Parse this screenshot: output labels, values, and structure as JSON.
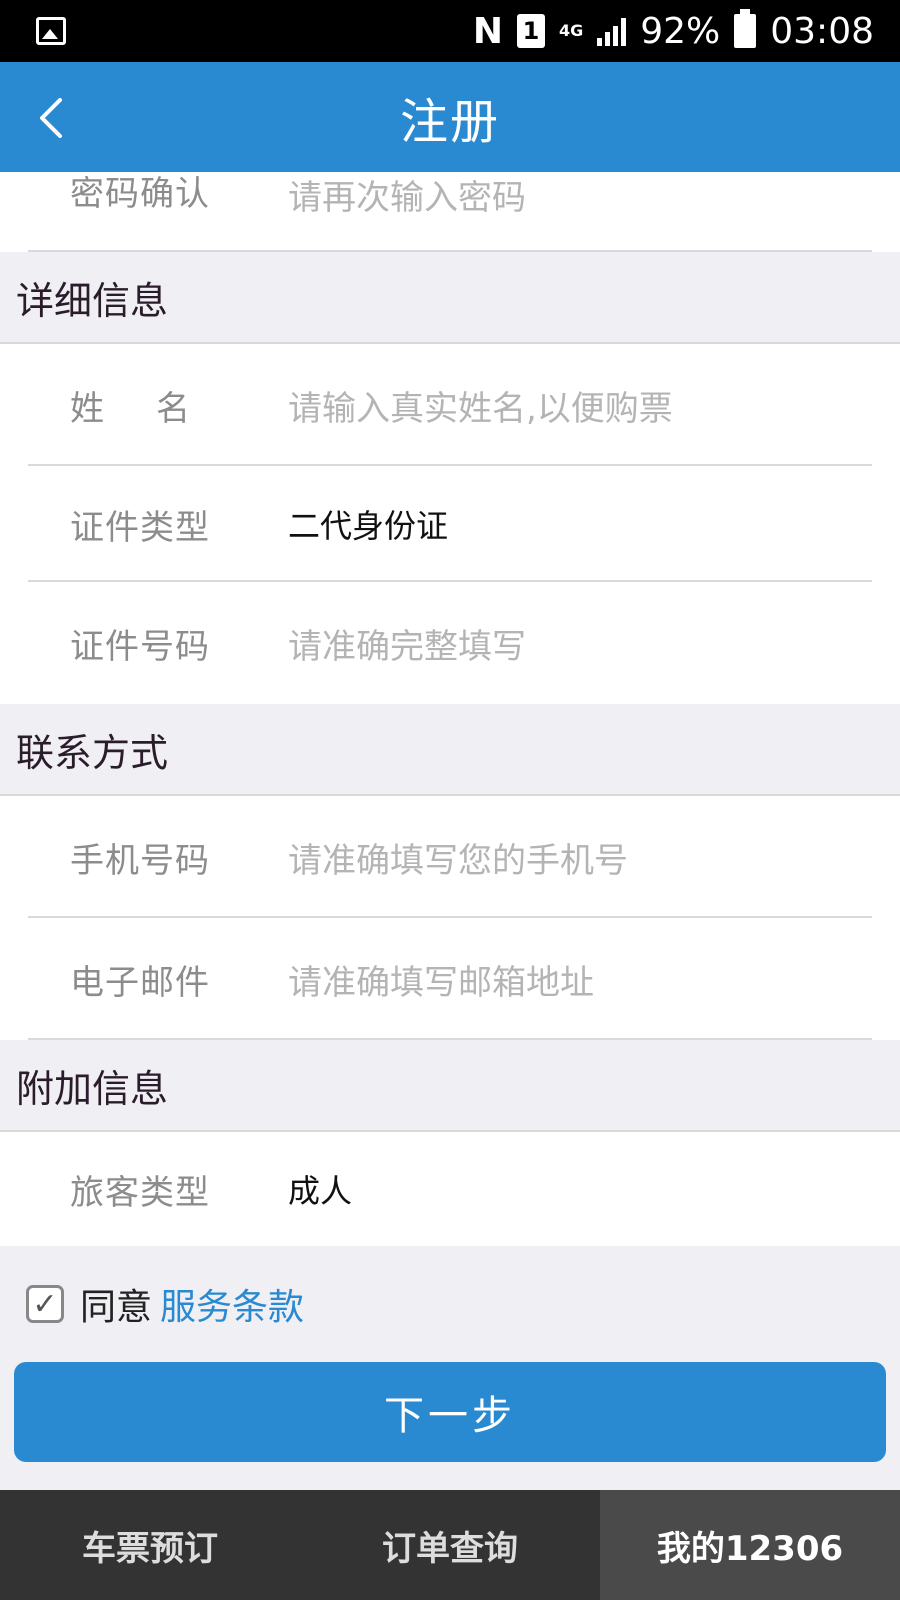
{
  "status_bar": {
    "battery": "92%",
    "time": "03:08",
    "nfc": "N",
    "sim": "1",
    "network": "4G"
  },
  "header": {
    "title": "注册"
  },
  "fields_top": [
    {
      "label": "密码确认",
      "placeholder": "请再次输入密码"
    }
  ],
  "sections": {
    "details": {
      "title": "详细信息",
      "name": {
        "label": "姓名",
        "placeholder": "请输入真实姓名,以便购票"
      },
      "id_type": {
        "label": "证件类型",
        "value": "二代身份证"
      },
      "id_number": {
        "label": "证件号码",
        "placeholder": "请准确完整填写"
      }
    },
    "contact": {
      "title": "联系方式",
      "phone": {
        "label": "手机号码",
        "placeholder": "请准确填写您的手机号"
      },
      "email": {
        "label": "电子邮件",
        "placeholder": "请准确填写邮箱地址"
      }
    },
    "extra": {
      "title": "附加信息",
      "passenger_type": {
        "label": "旅客类型",
        "value": "成人"
      }
    }
  },
  "agreement": {
    "text": "同意",
    "link": "服务条款",
    "checked": true
  },
  "next_button": "下一步",
  "tabs": [
    {
      "label": "车票预订"
    },
    {
      "label": "订单查询"
    },
    {
      "label": "我的12306"
    }
  ]
}
